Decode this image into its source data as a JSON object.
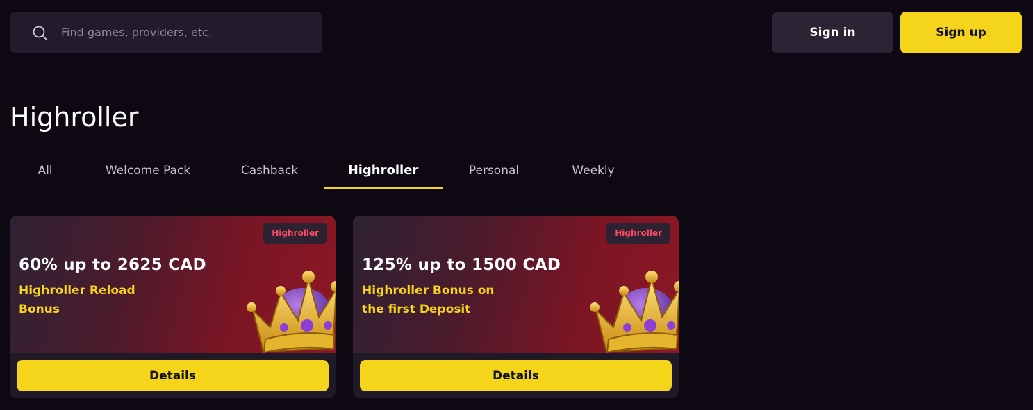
{
  "header": {
    "search_placeholder": "Find games, providers, etc.",
    "signin_label": "Sign in",
    "signup_label": "Sign up"
  },
  "page": {
    "title": "Highroller"
  },
  "tabs": [
    {
      "label": "All"
    },
    {
      "label": "Welcome Pack"
    },
    {
      "label": "Cashback"
    },
    {
      "label": "Highroller",
      "active": true
    },
    {
      "label": "Personal"
    },
    {
      "label": "Weekly"
    }
  ],
  "cards": [
    {
      "tag": "Highroller",
      "headline": "60% up to 2625 CAD",
      "subline": "Highroller Reload Bonus",
      "button": "Details"
    },
    {
      "tag": "Highroller",
      "headline": "125% up to 1500 CAD",
      "subline": "Highroller Bonus on the first Deposit",
      "button": "Details"
    }
  ],
  "colors": {
    "background": "#0d0812",
    "accent": "#f5d41c",
    "tag_text": "#ff4b63"
  },
  "icons": {
    "search": "search-icon",
    "crown": "crown-icon"
  }
}
